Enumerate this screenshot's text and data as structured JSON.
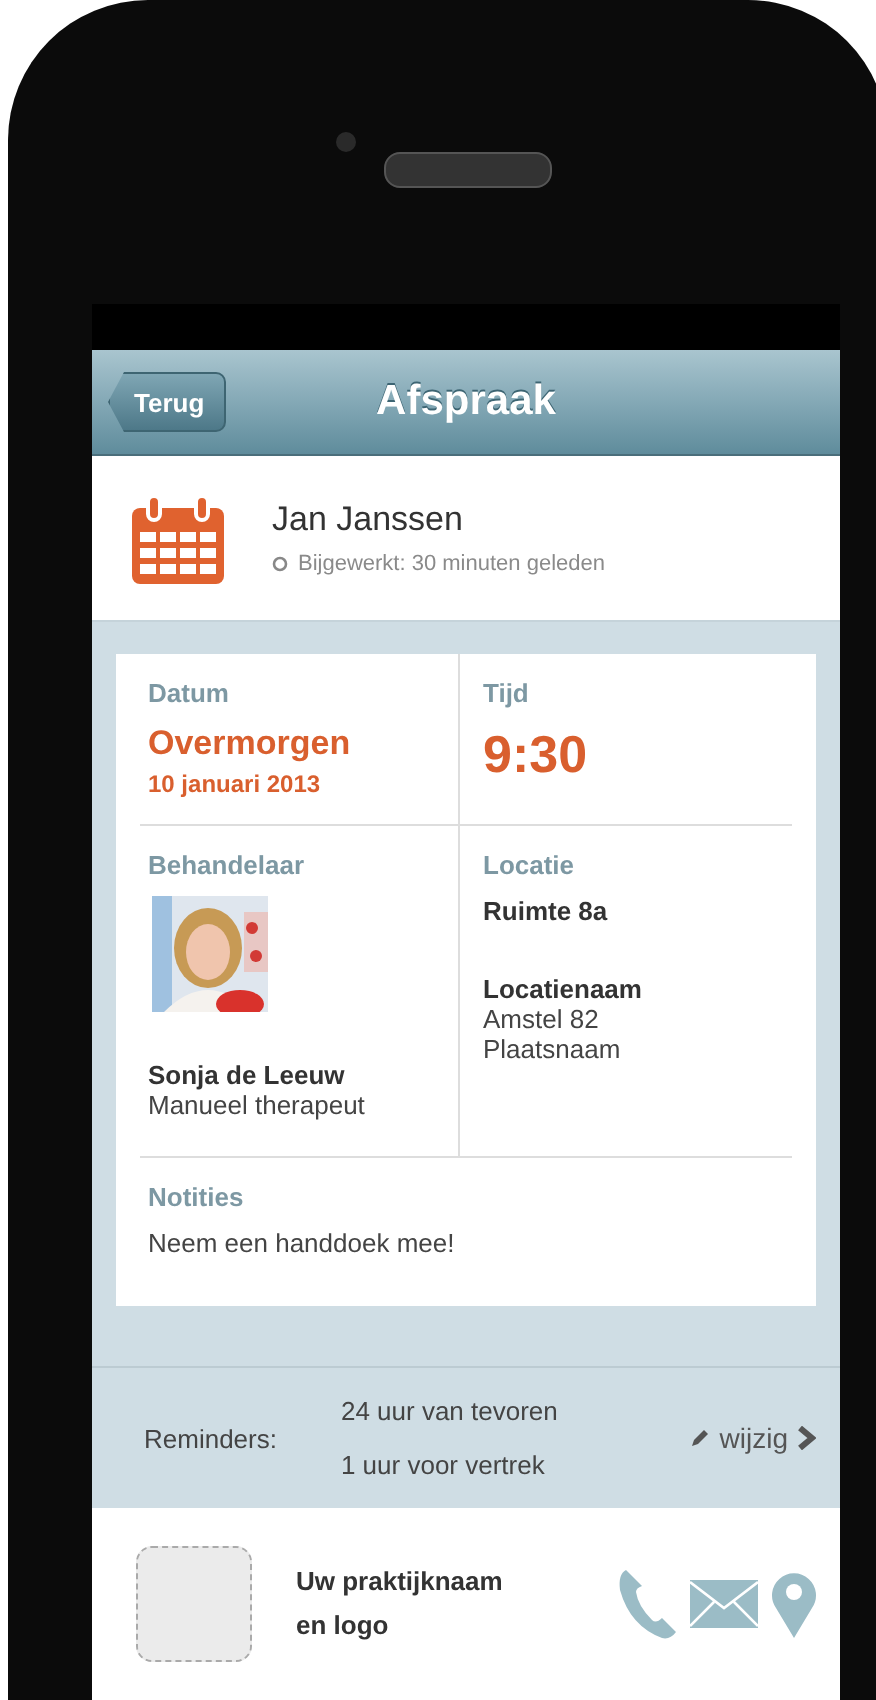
{
  "nav": {
    "back": "Terug",
    "title": "Afspraak"
  },
  "header": {
    "name": "Jan Janssen",
    "updated": "Bijgewerkt: 30 minuten geleden"
  },
  "date": {
    "label": "Datum",
    "relative": "Overmorgen",
    "date": "10 januari 2013"
  },
  "time": {
    "label": "Tijd",
    "value": "9:30"
  },
  "practitioner": {
    "label": "Behandelaar",
    "name": "Sonja de Leeuw",
    "role": "Manueel therapeut"
  },
  "location": {
    "label": "Locatie",
    "room": "Ruimte 8a",
    "name": "Locatienaam",
    "street": "Amstel 82",
    "city": "Plaatsnaam"
  },
  "notes": {
    "label": "Notities",
    "text": "Neem een handdoek mee!"
  },
  "reminders": {
    "label": "Reminders:",
    "items": [
      "24 uur van tevoren",
      "1 uur voor vertrek"
    ],
    "edit": "wijzig"
  },
  "footer": {
    "practice": "Uw praktijknaam\nen logo"
  }
}
